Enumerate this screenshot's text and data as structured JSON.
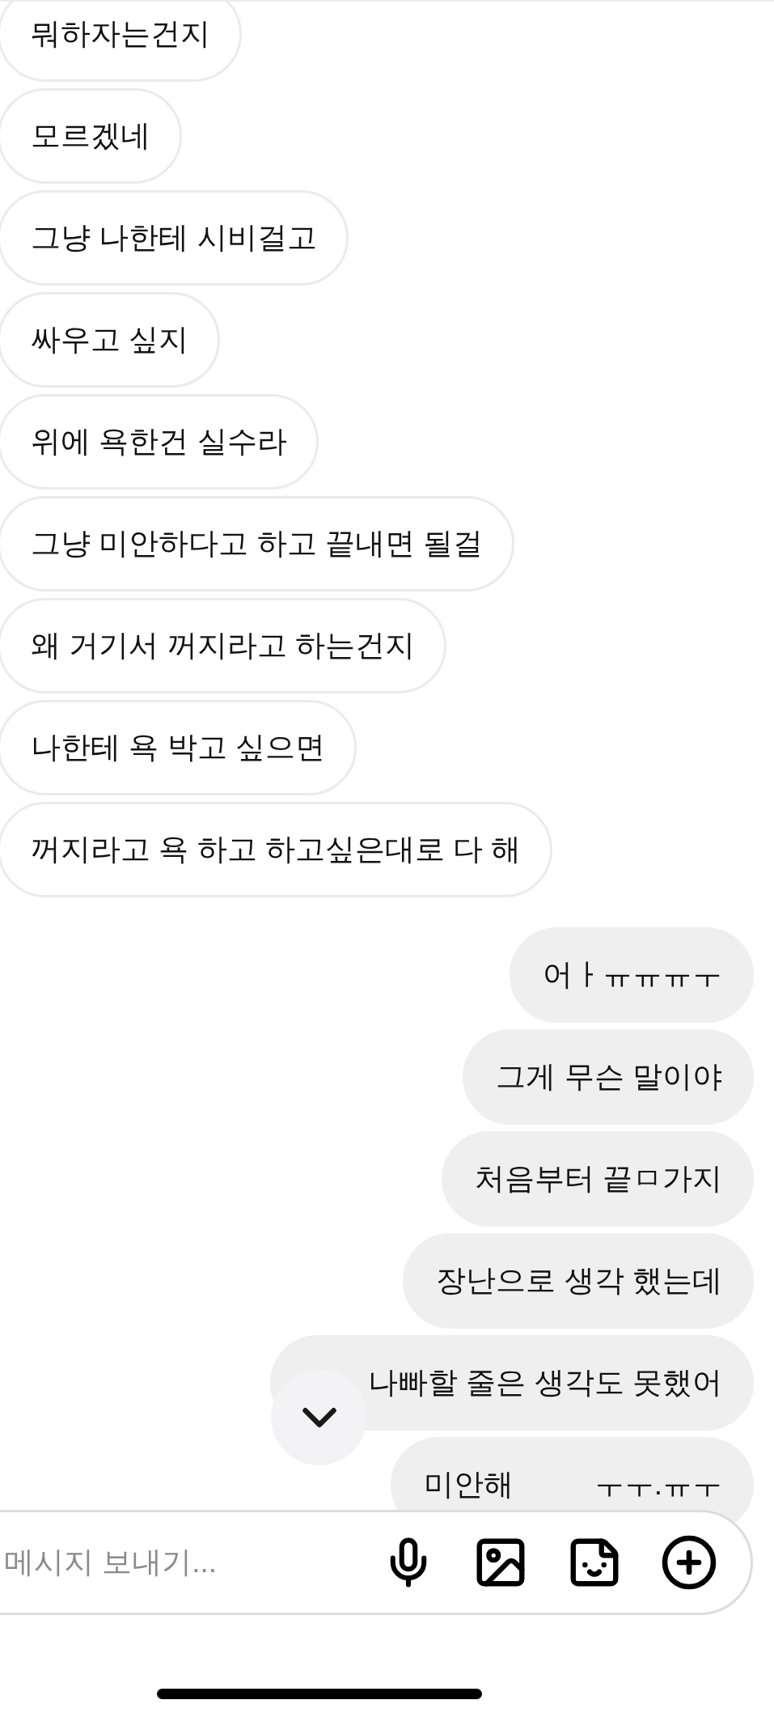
{
  "messages": [
    {
      "kind": "received",
      "text": "뭐하자는건지"
    },
    {
      "kind": "received",
      "text": "모르겠네"
    },
    {
      "kind": "received",
      "text": "그냥 나한테 시비걸고"
    },
    {
      "kind": "received",
      "text": "싸우고 싶지"
    },
    {
      "kind": "received",
      "text": "위에 욕한건 실수라"
    },
    {
      "kind": "received",
      "text": "그냥 미안하다고 하고 끝내면 될걸"
    },
    {
      "kind": "received",
      "text": "왜 거기서 꺼지라고 하는건지"
    },
    {
      "kind": "received",
      "text": "나한테 욕 박고 싶으면"
    },
    {
      "kind": "received",
      "text": "꺼지라고 욕 하고 하고싶은대로 다 해"
    },
    {
      "kind": "sent",
      "text": "어ㅏㅠㅠㅠㅜ"
    },
    {
      "kind": "sent",
      "text": "그게 무슨 말이야"
    },
    {
      "kind": "sent",
      "text": "처음부터 끝ㅁ가지"
    },
    {
      "kind": "sent",
      "text": "장난으로 생각 했는데"
    },
    {
      "kind": "sent",
      "text": "나빠할 줄은 생각도 못했어",
      "covered": true
    },
    {
      "kind": "sent",
      "text": "미안해",
      "text_2": "ㅜㅜ.ㅠㅜ"
    }
  ],
  "composer": {
    "placeholder": "메시지 보내기..."
  }
}
